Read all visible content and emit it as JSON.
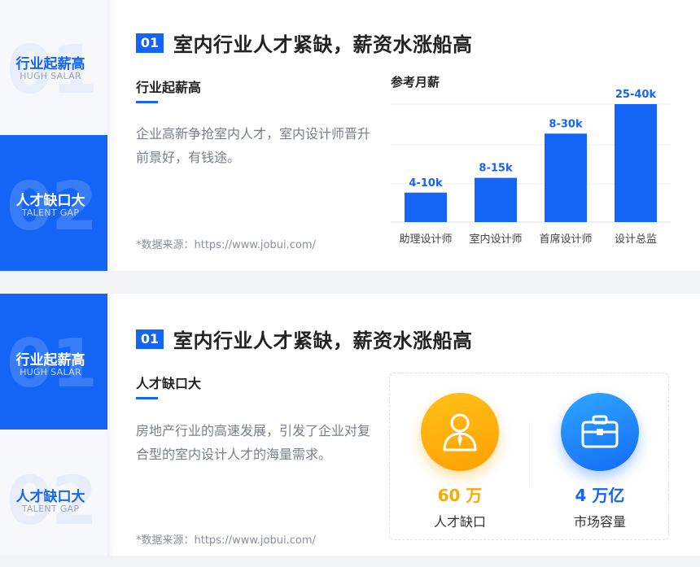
{
  "sidebar": {
    "items": [
      {
        "num": "01",
        "cn": "行业起薪高",
        "en": "HUGH SALAR"
      },
      {
        "num": "02",
        "cn": "人才缺口大",
        "en": "TALENT GAP"
      }
    ]
  },
  "section1": {
    "badge": "01",
    "title": "室内行业人才紧缺，薪资水涨船高",
    "subtitle": "行业起薪高",
    "desc": "企业高新争抢室内人才，室内设计师晋升前景好，有钱途。",
    "source": "*数据来源：https://www.jobui.com/"
  },
  "section2": {
    "badge": "01",
    "title": "室内行业人才紧缺，薪资水涨船高",
    "subtitle": "人才缺口大",
    "desc": "房地产行业的高速发展，引发了企业对复合型的室内设计人才的海量需求。",
    "source": "*数据来源：https://www.jobui.com/",
    "stats": [
      {
        "value": "60 万",
        "label": "人才缺口",
        "icon": "person-icon",
        "color": "#ffa800"
      },
      {
        "value": "4 万亿",
        "label": "市场容量",
        "icon": "briefcase-icon",
        "color": "#1464f6"
      }
    ]
  },
  "chart_data": {
    "type": "bar",
    "title": "参考月薪",
    "categories": [
      "助理设计师",
      "室内设计师",
      "首席设计师",
      "设计总监"
    ],
    "series": [
      {
        "values": [
          [
            4,
            10
          ],
          [
            8,
            15
          ],
          [
            8,
            30
          ],
          [
            25,
            40
          ]
        ]
      }
    ],
    "data_labels": [
      "4-10k",
      "8-15k",
      "8-30k",
      "25-40k"
    ],
    "ylabel": "",
    "xlabel": "",
    "grid": true,
    "bar_color": "#1464f6"
  }
}
